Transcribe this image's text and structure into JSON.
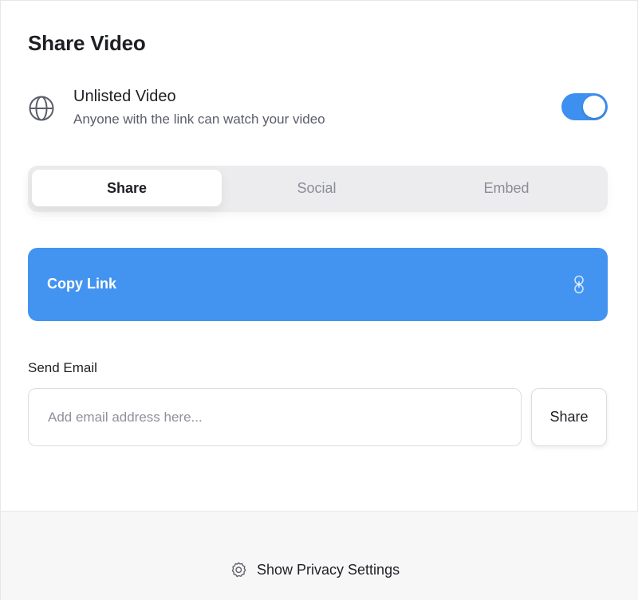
{
  "dialog": {
    "title": "Share Video"
  },
  "visibility": {
    "icon": "globe-icon",
    "title": "Unlisted Video",
    "subtitle": "Anyone with the link can watch your video",
    "toggle_on": true,
    "toggle_color": "#3d8ff0"
  },
  "tabs": [
    {
      "label": "Share",
      "active": true
    },
    {
      "label": "Social",
      "active": false
    },
    {
      "label": "Embed",
      "active": false
    }
  ],
  "copy_link": {
    "label": "Copy Link",
    "icon": "link-icon",
    "color": "#4394f0"
  },
  "email": {
    "label": "Send Email",
    "placeholder": "Add email address here...",
    "value": "",
    "button_label": "Share"
  },
  "footer": {
    "icon": "gear-icon",
    "privacy_label": "Show Privacy Settings"
  }
}
